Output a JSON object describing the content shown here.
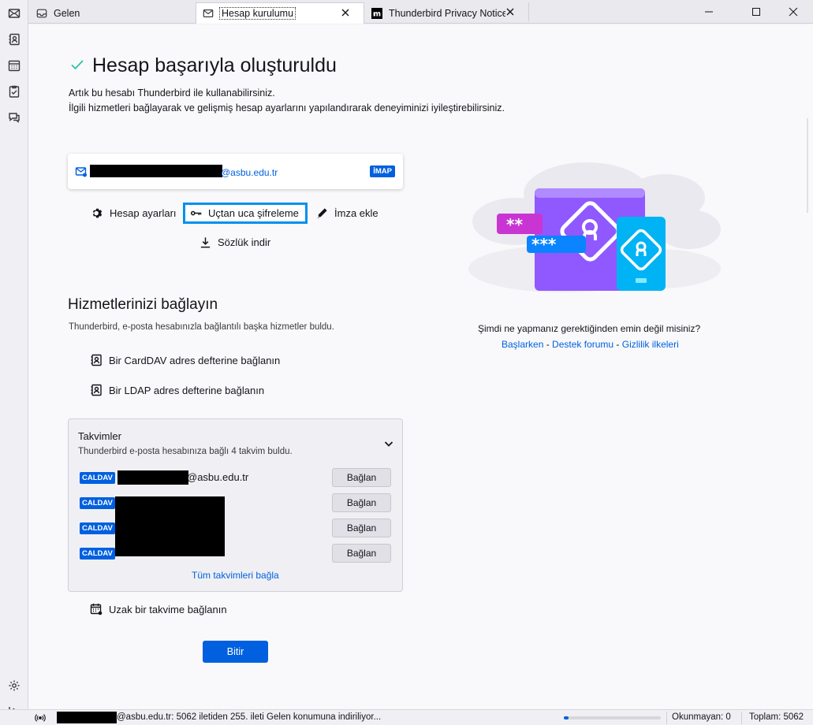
{
  "spaces": {
    "items": [
      {
        "name": "mail",
        "icon": "envelope-icon"
      },
      {
        "name": "address-book",
        "icon": "address-book-icon"
      },
      {
        "name": "calendar",
        "icon": "calendar-icon"
      },
      {
        "name": "tasks",
        "icon": "tasks-icon"
      },
      {
        "name": "chat",
        "icon": "chat-icon"
      }
    ],
    "bottom": [
      {
        "icon": "gear-icon"
      },
      {
        "icon": "collapse-icon"
      }
    ]
  },
  "tabs": [
    {
      "label": "Gelen",
      "icon": "inbox-icon",
      "active": false
    },
    {
      "label": "Hesap kurulumu",
      "icon": "envelope-icon",
      "active": true
    },
    {
      "label": "Thunderbird Privacy Notice",
      "icon": "mozilla-icon",
      "active": false
    }
  ],
  "setup": {
    "title": "Hesap başarıyla oluşturuldu",
    "line1": "Artık bu hesabı Thunderbird ile kullanabilirsiniz.",
    "line2": "İlgili hizmetleri bağlayarak ve gelişmiş hesap ayarlarını yapılandırarak deneyiminizi iyileştirebilirsiniz.",
    "account_email": "@asbu.edu.tr",
    "account_type": "İMAP",
    "actions": {
      "settings": "Hesap ayarları",
      "e2e": "Uçtan uca şifreleme",
      "signature": "İmza ekle",
      "dictionary": "Sözlük indir"
    },
    "services_title": "Hizmetlerinizi bağlayın",
    "services_sub": "Thunderbird, e-posta hesabınızla bağlantılı başka hizmetler buldu.",
    "carddav": "Bir CardDAV adres defterine bağlanın",
    "ldap": "Bir LDAP adres defterine bağlanın",
    "calendars": {
      "title": "Takvimler",
      "sub": "Thunderbird e-posta hesabınıza bağlı 4 takvim buldu.",
      "badge": "CALDAV",
      "first_email": "@asbu.edu.tr",
      "connect": "Bağlan",
      "connect_all": "Tüm takvimleri bağla"
    },
    "remote_calendar": "Uzak bir takvime bağlanın",
    "finish": "Bitir"
  },
  "help": {
    "question": "Şimdi ne yapmanız gerektiğinden emin değil misiniz?",
    "links": [
      "Başlarken",
      "Destek forumu",
      "Gizlilik ilkeleri"
    ],
    "separator": " - "
  },
  "status": {
    "message": "@asbu.edu.tr: 5062 iletiden 255. ileti Gelen konumuna indiriliyor...",
    "progress": 0.05,
    "unread": "Okunmayan: 0",
    "total": "Toplam: 5062"
  },
  "colors": {
    "accent": "#0060df",
    "focus": "#0090ed",
    "success": "#2ac3a2",
    "illus_purple": "#9059ff",
    "illus_pink": "#c935d3",
    "illus_cyan": "#00b3f4"
  }
}
